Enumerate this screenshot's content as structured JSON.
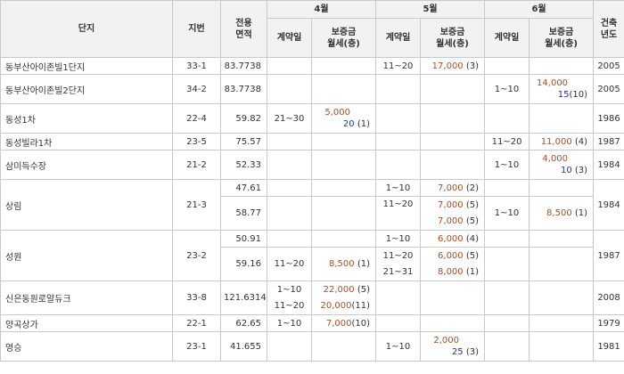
{
  "header": {
    "complex": "단지",
    "lot": "지번",
    "area_l1": "전용",
    "area_l2": "면적",
    "built_l1": "건축",
    "built_l2": "년도",
    "months": [
      "4월",
      "5월",
      "6월"
    ],
    "contract_day": "계약일",
    "deposit": "보증금",
    "rent": "월세(층)"
  },
  "rows": {
    "r1": {
      "name": "동부산아이존빌1단지",
      "lot": "33-1",
      "area": "83.7738",
      "m5_day": "11~20",
      "m5_dep": "17,000",
      "m5_cnt": "(3)",
      "year": "2005"
    },
    "r2": {
      "name": "동부산아이존빌2단지",
      "lot": "34-2",
      "area": "83.7738",
      "m6_day": "1~10",
      "m6_dep": "14,000",
      "m6_mon": "15",
      "m6_cnt": "(10)",
      "year": "2005"
    },
    "r3": {
      "name": "동성1차",
      "lot": "22-4",
      "area": "59.82",
      "m4_day": "21~30",
      "m4_dep": "5,000",
      "m4_mon": "20",
      "m4_cnt": "(1)",
      "year": "1986"
    },
    "r4": {
      "name": "동성빌라1차",
      "lot": "23-5",
      "area": "75.57",
      "m6_day": "11~20",
      "m6_dep": "11,000",
      "m6_cnt": "(4)",
      "year": "1987"
    },
    "r5": {
      "name": "삼미득수장",
      "lot": "21-2",
      "area": "52.33",
      "m6_day": "1~10",
      "m6_dep": "4,000",
      "m6_mon": "10",
      "m6_cnt": "(3)",
      "year": "1984"
    },
    "r6": {
      "name": "상림",
      "lot": "21-3",
      "year": "1984",
      "a1": "47.61",
      "a1_m5_day": "1~10",
      "a1_m5_dep": "7,000",
      "a1_m5_cnt": "(2)",
      "a2": "58.77",
      "a2_m5_day": "11~20",
      "a2_m5_dep1": "7,000",
      "a2_m5_cnt1": "(5)",
      "a2_m5_dep2": "7,000",
      "a2_m5_cnt2": "(5)",
      "a2_m6_day": "1~10",
      "a2_m6_dep": "8,500",
      "a2_m6_cnt": "(1)"
    },
    "r7": {
      "name": "성원",
      "lot": "23-2",
      "year": "1987",
      "a1": "50.91",
      "a1_m5_day": "1~10",
      "a1_m5_dep": "6,000",
      "a1_m5_cnt": "(4)",
      "a2": "59.16",
      "a2_m4_day": "11~20",
      "a2_m4_dep": "8,500",
      "a2_m4_cnt": "(1)",
      "a2_m5_day1": "11~20",
      "a2_m5_dep1": "6,000",
      "a2_m5_cnt1": "(5)",
      "a2_m5_day2": "21~31",
      "a2_m5_dep2": "8,000",
      "a2_m5_cnt2": "(1)"
    },
    "r8": {
      "name": "신은동원로얄듀크",
      "lot": "33-8",
      "area": "121.6314",
      "year": "2008",
      "m4_day1": "1~10",
      "m4_dep1": "22,000",
      "m4_cnt1": "(5)",
      "m4_day2": "11~20",
      "m4_dep2": "20,000",
      "m4_cnt2": "(11)"
    },
    "r9": {
      "name": "양곡상가",
      "lot": "22-1",
      "area": "62.65",
      "m4_day": "1~10",
      "m4_dep": "7,000",
      "m4_cnt": "(10)",
      "year": "1979"
    },
    "r10": {
      "name": "영승",
      "lot": "23-1",
      "area": "41.655",
      "m5_day": "1~10",
      "m5_dep": "2,000",
      "m5_mon": "25",
      "m5_cnt": "(3)",
      "year": "1981"
    }
  },
  "colors": {
    "deposit": "#a0522d",
    "monthly": "#1f3a93",
    "header_bg": "#f2f2f2",
    "border": "#c9c9c9"
  }
}
